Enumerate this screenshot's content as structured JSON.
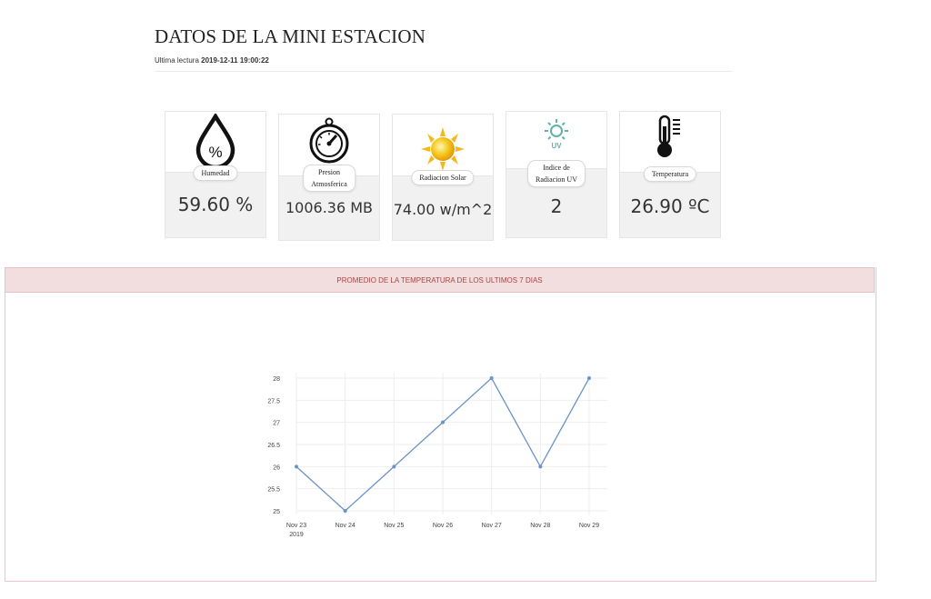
{
  "header": {
    "title": "DATOS DE LA MINI ESTACION",
    "last_reading_label": "Ultima lectura",
    "last_reading_value": "2019-12-11 19:00:22"
  },
  "cards": [
    {
      "label": "Humedad",
      "value": "59.60 %",
      "icon": "humidity-drop-icon"
    },
    {
      "label_line1": "Presion",
      "label_line2": "Atmosferica",
      "value": "1006.36 MB",
      "icon": "barometer-icon"
    },
    {
      "label": "Radiacion Solar",
      "value": "74.00 w/m^2",
      "icon": "sun-icon"
    },
    {
      "label_line1": "Indice de",
      "label_line2": "Radiacion UV",
      "value": "2",
      "icon": "uv-icon"
    },
    {
      "label": "Temperatura",
      "value": "26.90 ºC",
      "icon": "thermometer-icon"
    }
  ],
  "panel": {
    "heading": "PROMEDIO DE LA TEMPERATURA DE LOS ULTIMOS 7 DIAS"
  },
  "colors": {
    "line": "#6b93c8",
    "panel_heading_bg": "#f2dede",
    "panel_heading_text": "#a94442",
    "uv_icon": "#5fb3a8"
  },
  "chart_data": {
    "type": "line",
    "categories": [
      "Nov 23",
      "Nov 24",
      "Nov 25",
      "Nov 26",
      "Nov 27",
      "Nov 28",
      "Nov 29"
    ],
    "year_label": "2019",
    "values": [
      26,
      25,
      26,
      27,
      28,
      26,
      28
    ],
    "yticks": [
      25,
      25.5,
      26,
      26.5,
      27,
      27.5,
      28
    ],
    "ylim": [
      25,
      28
    ],
    "grid": true
  }
}
